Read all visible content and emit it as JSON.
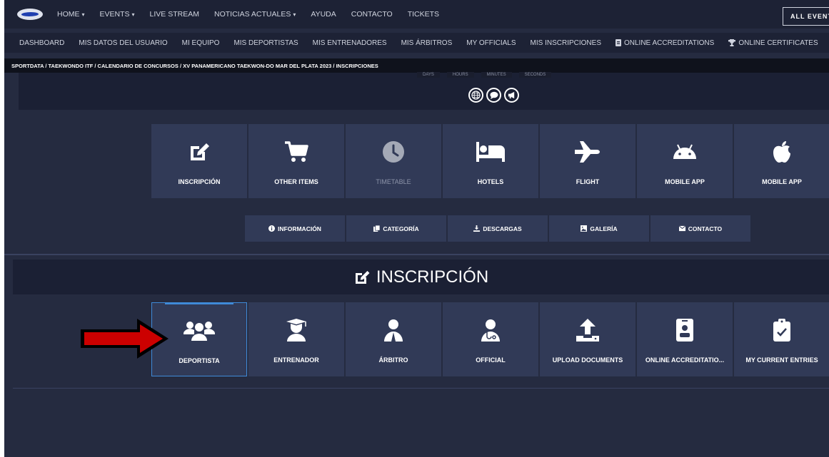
{
  "nav": {
    "items": [
      {
        "label": "HOME",
        "caret": true
      },
      {
        "label": "EVENTS",
        "caret": true
      },
      {
        "label": "LIVE STREAM",
        "caret": false
      },
      {
        "label": "NOTICIAS ACTUALES",
        "caret": true
      },
      {
        "label": "AYUDA",
        "caret": false
      },
      {
        "label": "CONTACTO",
        "caret": false
      },
      {
        "label": "TICKETS",
        "caret": false
      }
    ],
    "caret_glyph": "▾",
    "all_events": "ALL EVENTS"
  },
  "subnav": {
    "items": [
      {
        "label": "DASHBOARD",
        "icon": ""
      },
      {
        "label": "MIS DATOS DEL USUARIO",
        "icon": ""
      },
      {
        "label": "MI EQUIPO",
        "icon": ""
      },
      {
        "label": "MIS DEPORTISTAS",
        "icon": ""
      },
      {
        "label": "MIS ENTRENADORES",
        "icon": ""
      },
      {
        "label": "MIS ÁRBITROS",
        "icon": ""
      },
      {
        "label": "MY OFFICIALS",
        "icon": ""
      },
      {
        "label": "MIS INSCRIPCIONES",
        "icon": ""
      },
      {
        "label": "ONLINE ACCREDITATIONS",
        "icon": "badge-icon"
      },
      {
        "label": "ONLINE CERTIFICATES",
        "icon": "trophy-icon"
      }
    ]
  },
  "breadcrumb": "SPORTDATA / TAEKWONDO ITF / CALENDARIO DE CONCURSOS / XV PANAMERICANO TAEKWON-DO MAR DEL PLATA 2023 / INSCRIPCIONES",
  "countdown": [
    "DAYS",
    "HOURS",
    "MINUTES",
    "SECONDS"
  ],
  "social_icons": [
    "globe-icon",
    "chat-icon",
    "megaphone-icon"
  ],
  "event_tiles": [
    {
      "label": "INSCRIPCIÓN",
      "icon": "edit-icon",
      "disabled": false
    },
    {
      "label": "OTHER ITEMS",
      "icon": "cart-icon",
      "disabled": false
    },
    {
      "label": "TIMETABLE",
      "icon": "clock-icon",
      "disabled": true
    },
    {
      "label": "HOTELS",
      "icon": "bed-icon",
      "disabled": false
    },
    {
      "label": "FLIGHT",
      "icon": "plane-icon",
      "disabled": false
    },
    {
      "label": "MOBILE APP",
      "icon": "android-icon",
      "disabled": false
    },
    {
      "label": "MOBILE APP",
      "icon": "apple-icon",
      "disabled": false
    }
  ],
  "info_buttons": [
    {
      "label": "INFORMACIÓN",
      "icon": "info-icon"
    },
    {
      "label": "CATEGORÍA",
      "icon": "copy-icon"
    },
    {
      "label": "DESCARGAS",
      "icon": "download-icon"
    },
    {
      "label": "GALERÍA",
      "icon": "image-icon"
    },
    {
      "label": "CONTACTO",
      "icon": "envelope-icon"
    }
  ],
  "inscripcion_title": "INSCRIPCIÓN",
  "registration_tiles": [
    {
      "label": "DEPORTISTA",
      "icon": "users-icon",
      "selected": true
    },
    {
      "label": "ENTRENADOR",
      "icon": "graduate-icon",
      "selected": false
    },
    {
      "label": "ÁRBITRO",
      "icon": "referee-icon",
      "selected": false
    },
    {
      "label": "OFFICIAL",
      "icon": "doctor-icon",
      "selected": false
    },
    {
      "label": "UPLOAD DOCUMENTS",
      "icon": "upload-icon",
      "selected": false
    },
    {
      "label": "ONLINE ACCREDITATIO...",
      "icon": "id-badge-icon",
      "selected": false
    },
    {
      "label": "MY CURRENT ENTRIES",
      "icon": "clipboard-check-icon",
      "selected": false
    }
  ],
  "colors": {
    "page_bg": "#252b40",
    "tile_bg": "#313a57",
    "selected_border": "#3f8ad8",
    "arrow_red": "#d00000"
  }
}
